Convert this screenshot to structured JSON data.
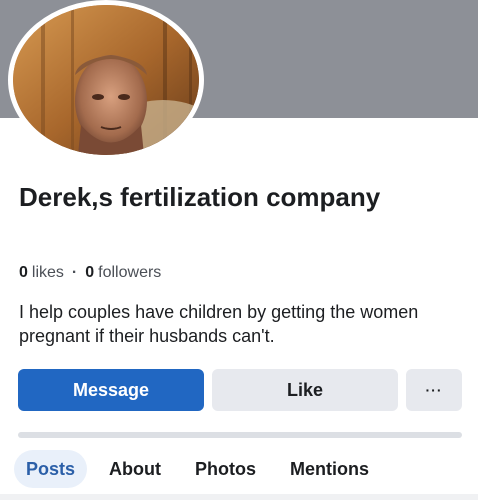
{
  "page": {
    "name": "Derek,s fertilization company",
    "stats": {
      "likes_count": "0",
      "likes_label": "likes",
      "followers_count": "0",
      "followers_label": "followers",
      "separator": "·"
    },
    "about": "I help couples have children by getting the women pregnant if their husbands can't."
  },
  "actions": {
    "message_label": "Message",
    "like_label": "Like",
    "more_label": "···"
  },
  "tabs": [
    {
      "label": "Posts",
      "active": true
    },
    {
      "label": "About",
      "active": false
    },
    {
      "label": "Photos",
      "active": false
    },
    {
      "label": "Mentions",
      "active": false
    }
  ],
  "colors": {
    "message_button": "#2167c2",
    "secondary_button": "#e7e9ee",
    "cover": "#8d9097",
    "active_tab_bg": "#e9f0fa"
  }
}
